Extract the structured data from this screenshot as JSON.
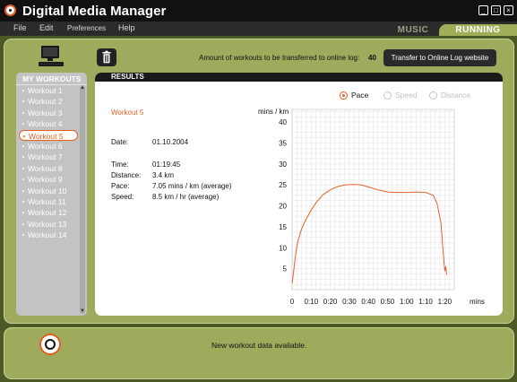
{
  "window": {
    "title": "Digital Media Manager",
    "controls": [
      "_",
      "□",
      "×"
    ]
  },
  "menu": {
    "items": [
      "File",
      "Edit",
      "Preferences",
      "Help"
    ]
  },
  "mode_tabs": {
    "music": "MUSIC",
    "running": "RUNNING"
  },
  "sidebar": {
    "header": "MY WORKOUTS",
    "items": [
      "Workout 1",
      "Workout 2",
      "Workout 3",
      "Workout 4",
      "Workout 5",
      "Workout 6",
      "Workout 7",
      "Workout 8",
      "Workout 9",
      "Workout 10",
      "Workout 11",
      "Workout 12",
      "Workout 13",
      "Workout 14"
    ],
    "selected": "Workout 5",
    "scroll_up": "▲",
    "scroll_down": "▼"
  },
  "transfer": {
    "label": "Amount of workouts to be transferred to online log:",
    "count": "40",
    "button": "Transfer to Online Log website"
  },
  "results": {
    "header": "RESULTS",
    "metric_options": [
      {
        "label": "Pace",
        "checked": true
      },
      {
        "label": "Speed",
        "checked": false
      },
      {
        "label": "Distance",
        "checked": false
      }
    ],
    "workout_title": "Workout 5",
    "details": {
      "date": {
        "label": "Date:",
        "value": "01.10.2004"
      },
      "time": {
        "label": "Time:",
        "value": "01:19:45"
      },
      "distance": {
        "label": "Distance:",
        "value": "3.4 km"
      },
      "pace": {
        "label": "Pace:",
        "value": "7.05 mins / km (average)"
      },
      "speed": {
        "label": "Speed:",
        "value": "8.5 km / hr (average)"
      }
    }
  },
  "chart_data": {
    "type": "line",
    "ylabel": "mins / km",
    "xlabel": "mins",
    "x_tick_labels": [
      "0",
      "0:10",
      "0:20",
      "0:30",
      "0:40",
      "0:50",
      "1:00",
      "1:10",
      "1:20"
    ],
    "y_ticks": [
      5,
      10,
      15,
      20,
      25,
      30,
      35,
      40
    ],
    "ylim": [
      0,
      43
    ],
    "xlim": [
      0,
      85
    ],
    "grid": true,
    "series": [
      {
        "color": "#e3622b",
        "x": [
          0,
          1,
          2,
          3,
          5,
          7,
          10,
          13,
          16,
          20,
          24,
          28,
          32,
          36,
          40,
          45,
          50,
          55,
          60,
          65,
          70,
          74,
          76,
          78,
          79,
          80,
          80.5,
          81
        ],
        "y": [
          1.5,
          5,
          9,
          11.5,
          14.5,
          16.5,
          19,
          21,
          22.6,
          23.8,
          24.6,
          25,
          25.1,
          25,
          24.5,
          23.8,
          23.3,
          23.2,
          23.2,
          23.3,
          23.2,
          22.5,
          20.5,
          16,
          10,
          4.5,
          5.5,
          3.5
        ]
      }
    ]
  },
  "status": {
    "message": "New workout data available."
  },
  "colors": {
    "accent": "#e35f24",
    "frame": "#9eab5d",
    "shell": "#4b5a24",
    "tab_active": "#a0ad59"
  }
}
